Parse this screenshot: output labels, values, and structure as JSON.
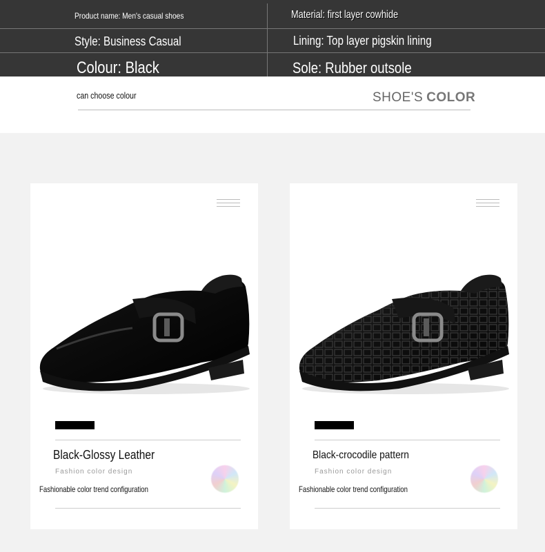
{
  "specs": {
    "product_name": "Product name: Men's casual shoes",
    "material": "Material: first layer cowhide",
    "style": "Style: Business Casual",
    "lining": "Lining: Top layer pigskin lining",
    "colour": "Colour: Black",
    "sole": "Sole: Rubber outsole"
  },
  "header": {
    "choose_colour": "can choose colour",
    "shoes_word": "SHOE'S",
    "color_word": "COLOR"
  },
  "cards": [
    {
      "name": "Black-Glossy Leather",
      "design": "Fashion color design",
      "config": "Fashionable color trend configuration",
      "swatch_color": "#000000"
    },
    {
      "name": "Black-crocodile pattern",
      "design": "Fashion color design",
      "config": "Fashionable color trend configuration",
      "swatch_color": "#000000"
    }
  ],
  "colors": {
    "spec_bg": "#363636",
    "page_bg": "#f2f2f2",
    "card_bg": "#ffffff"
  }
}
